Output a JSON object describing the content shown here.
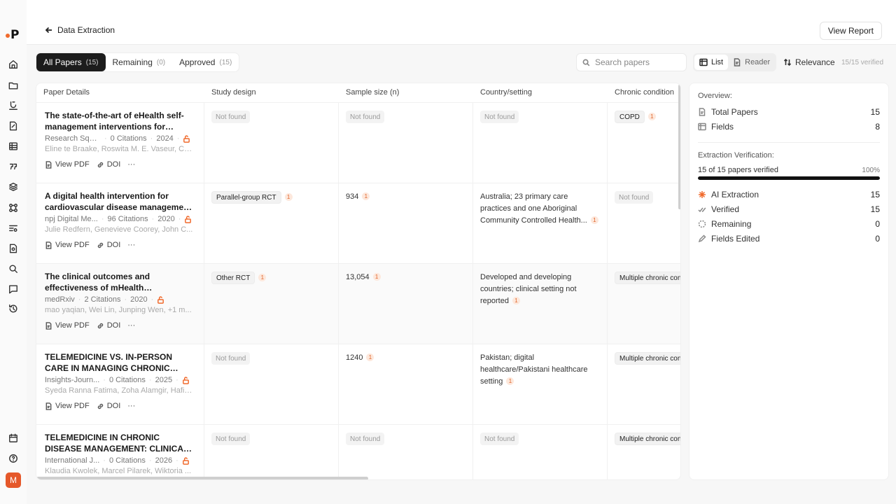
{
  "header": {
    "back_label": "Data Extraction",
    "view_report": "View Report"
  },
  "tabs": [
    {
      "label": "All Papers",
      "count": "(15)"
    },
    {
      "label": "Remaining",
      "count": "(0)"
    },
    {
      "label": "Approved",
      "count": "(15)"
    }
  ],
  "search": {
    "placeholder": "Search papers"
  },
  "view": {
    "list": "List",
    "reader": "Reader"
  },
  "sort": {
    "label": "Relevance"
  },
  "verified_count": "15/15 verified",
  "columns": [
    "Paper Details",
    "Study design",
    "Sample size (n)",
    "Country/setting",
    "Chronic condition"
  ],
  "actions": {
    "pdf": "View PDF",
    "doi": "DOI",
    "more": "···"
  },
  "papers": [
    {
      "title": "The state-of-the-art of eHealth self-management interventions for people...",
      "source": "Research Square",
      "citations": "0 Citations",
      "year": "2024",
      "authors": "Eline te Braake, Roswita M. E. Vaseur, Ch...",
      "study_design": "Not found",
      "sample_size": "Not found",
      "country": "Not found",
      "condition": "COPD"
    },
    {
      "title": "A digital health intervention for cardiovascular disease management ...",
      "source": "npj Digital Me...",
      "citations": "96 Citations",
      "year": "2020",
      "authors": "Julie Redfern, Genevieve Coorey, John C...",
      "study_design": "Parallel-group RCT",
      "sample_size": "934",
      "country": "Australia; 23 primary care practices and one Aboriginal Community Controlled Health...",
      "condition": "Not found"
    },
    {
      "title": "The clinical outcomes and effectiveness of mHealth intervention...",
      "source": "medRxiv",
      "citations": "2 Citations",
      "year": "2020",
      "authors": "mao yaqian, Wei Lin, Junping Wen, +1 m...",
      "study_design": "Other RCT",
      "sample_size": "13,054",
      "country": "Developed and developing countries; clinical setting not reported",
      "condition": "Multiple chronic conditions"
    },
    {
      "title": "TELEMEDICINE VS. IN-PERSON CARE IN MANAGING CHRONIC DISEASES – ...",
      "source": "Insights-Journ...",
      "citations": "0 Citations",
      "year": "2025",
      "authors": "Syeda Ranna Fatima, Zoha Alamgir, Hafiz...",
      "study_design": "Not found",
      "sample_size": "1240",
      "country": "Pakistan; digital healthcare/Pakistani healthcare setting",
      "condition": "Multiple chronic conditions"
    },
    {
      "title": "TELEMEDICINE IN CHRONIC DISEASE MANAGEMENT: CLINICAL EFFICACY,...",
      "source": "International J...",
      "citations": "0 Citations",
      "year": "2026",
      "authors": "Klaudia Kwolek, Marcel Pilarek, Wiktoria ...",
      "study_design": "Not found",
      "sample_size": "Not found",
      "country": "Not found",
      "condition": "Multiple chronic conditions"
    }
  ],
  "badge_value": "1",
  "panel": {
    "overview_title": "Overview:",
    "total_papers_label": "Total Papers",
    "total_papers": "15",
    "fields_label": "Fields",
    "fields": "8",
    "verification_title": "Extraction Verification:",
    "progress_text": "15 of 15 papers verified",
    "progress_pct": "100%",
    "progress_fraction": 1.0,
    "ai_label": "AI Extraction",
    "ai": "15",
    "verified_label": "Verified",
    "verified": "15",
    "remaining_label": "Remaining",
    "remaining": "0",
    "edited_label": "Fields Edited",
    "edited": "0"
  },
  "user": {
    "initial": "M"
  },
  "colors": {
    "accent": "#f06a2c",
    "avatar": "#e5582a",
    "active_tab": "#1c1c1c"
  }
}
